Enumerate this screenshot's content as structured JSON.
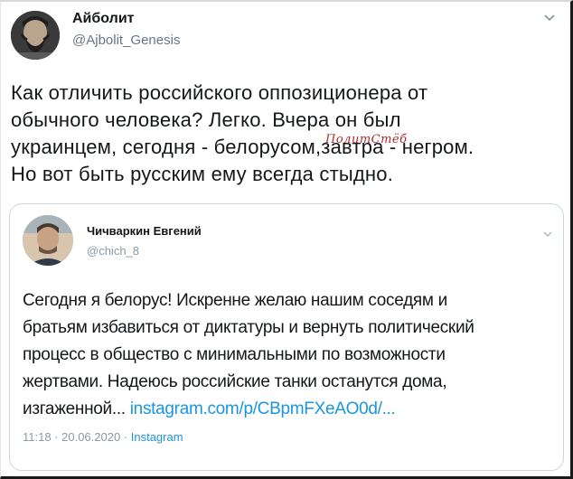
{
  "tweet": {
    "author": {
      "name": "Айболит",
      "handle": "@Ajbolit_Genesis"
    },
    "text_lines": [
      "Как отличить российского оппозиционера от",
      "обычного человека? Легко. Вчера он был",
      "украинцем, сегодня - белорусом,завтра - негром.",
      "Но вот быть русским ему всегда стыдно."
    ],
    "menu_icon": "chevron-down-icon"
  },
  "watermark": "ПолитСтёб",
  "quoted_tweet": {
    "author": {
      "name": "Чичваркин Евгений",
      "handle": "@chich_8"
    },
    "text_lines": [
      "Сегодня я белорус! Искренне желаю нашим соседям и",
      "братьям избавиться от диктатуры и вернуть политический",
      "процесс в общество с минимальными по возможности",
      "жертвами.  Надеюсь российские танки останутся дома,"
    ],
    "last_line_text": "изгаженной... ",
    "link": "instagram.com/p/CBpmFXeAO0d/...",
    "timestamp": "11:18 · 20.06.2020 · ",
    "source": "Instagram",
    "menu_icon": "chevron-down-icon"
  },
  "colors": {
    "link": "#1b95e0",
    "text": "#14171a",
    "muted": "#657786",
    "border": "#ccd6dd",
    "watermark": "#b02a2a"
  }
}
